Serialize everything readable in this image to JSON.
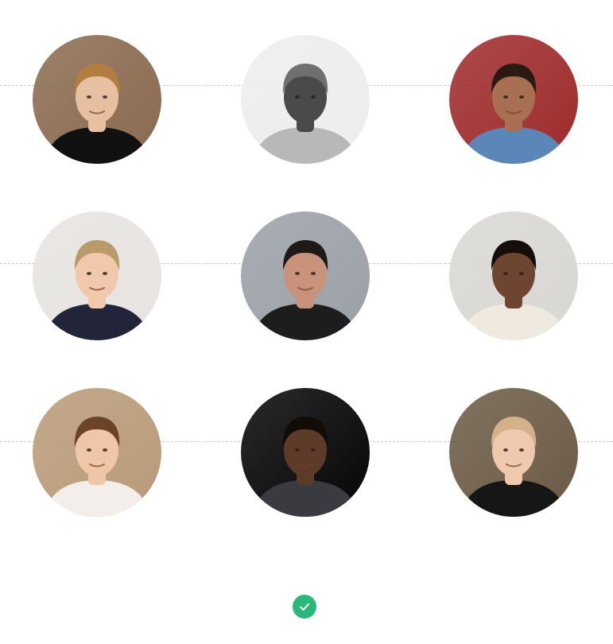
{
  "avatars": [
    {
      "row": 1,
      "col": 1,
      "bg": "#8a6a4f",
      "skin": "#e7c0a2",
      "hair": "#b27d3f",
      "shirt": "#111111",
      "grayscale": false
    },
    {
      "row": 1,
      "col": 2,
      "bg": "#ededed",
      "skin": "#4a4a4a",
      "hair": "#6f6f6f",
      "shirt": "#b8b8b8",
      "grayscale": true
    },
    {
      "row": 1,
      "col": 3,
      "bg": "#9e2b2b",
      "skin": "#a86f52",
      "hair": "#2b1a12",
      "shirt": "#5a86b8",
      "grayscale": false
    },
    {
      "row": 2,
      "col": 1,
      "bg": "#e6e3e0",
      "skin": "#f1c8ab",
      "hair": "#b99a6b",
      "shirt": "#22243a",
      "grayscale": false
    },
    {
      "row": 2,
      "col": 2,
      "bg": "#9aa0a6",
      "skin": "#c8937a",
      "hair": "#1f1a18",
      "shirt": "#1d1d1d",
      "grayscale": false
    },
    {
      "row": 2,
      "col": 3,
      "bg": "#d9d7d3",
      "skin": "#6e4530",
      "hair": "#150e0b",
      "shirt": "#efe9df",
      "grayscale": false
    },
    {
      "row": 3,
      "col": 1,
      "bg": "#b89a78",
      "skin": "#efc6a8",
      "hair": "#6b4428",
      "shirt": "#f3eee9",
      "grayscale": false
    },
    {
      "row": 3,
      "col": 2,
      "bg": "#050505",
      "skin": "#5e3a28",
      "hair": "#120c09",
      "shirt": "#3a3b40",
      "grayscale": false
    },
    {
      "row": 3,
      "col": 3,
      "bg": "#6b5a45",
      "skin": "#f0c8ae",
      "hair": "#d6b08a",
      "shirt": "#161616",
      "grayscale": false
    }
  ],
  "confirm": {
    "icon": "checkmark-icon",
    "color": "#2ab77a"
  }
}
